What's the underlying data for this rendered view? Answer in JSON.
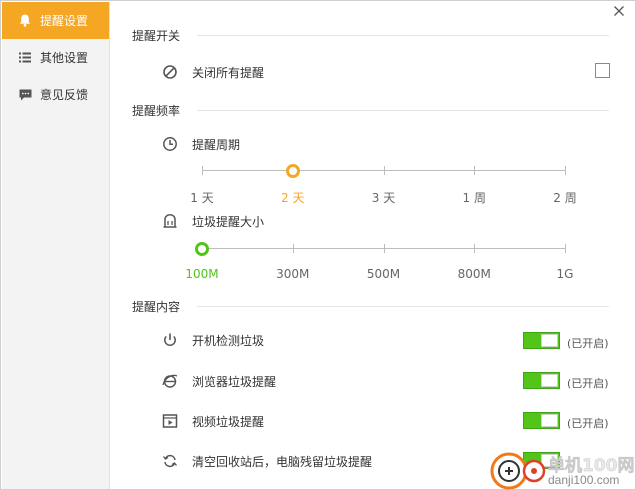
{
  "sidebar": {
    "items": [
      {
        "label": "提醒设置",
        "icon": "bell-icon",
        "active": true
      },
      {
        "label": "其他设置",
        "icon": "list-icon",
        "active": false
      },
      {
        "label": "意见反馈",
        "icon": "chat-icon",
        "active": false
      }
    ]
  },
  "sections": {
    "switch_title": "提醒开关",
    "frequency_title": "提醒频率",
    "content_title": "提醒内容"
  },
  "disable_all": {
    "label": "关闭所有提醒",
    "checked": false
  },
  "period": {
    "label": "提醒周期",
    "ticks": [
      "1 天",
      "2 天",
      "3 天",
      "1 周",
      "2 周"
    ],
    "selected_index": 1
  },
  "junk_size": {
    "label": "垃圾提醒大小",
    "ticks": [
      "100M",
      "300M",
      "500M",
      "800M",
      "1G"
    ],
    "selected_index": 0
  },
  "content_items": [
    {
      "label": "开机检测垃圾",
      "icon": "power-icon",
      "status": "(已开启)",
      "on": true
    },
    {
      "label": "浏览器垃圾提醒",
      "icon": "browser-icon",
      "status": "(已开启)",
      "on": true
    },
    {
      "label": "视频垃圾提醒",
      "icon": "video-icon",
      "status": "(已开启)",
      "on": true
    },
    {
      "label": "清空回收站后，电脑残留垃圾提醒",
      "icon": "recycle-icon",
      "status": "",
      "on": true
    }
  ],
  "watermark": {
    "text": "单机100网",
    "subtext": "danji100.com"
  },
  "colors": {
    "accent": "#f5a623",
    "green": "#52c41a",
    "period_thumb": "#f5a623",
    "size_thumb": "#52c41a"
  }
}
